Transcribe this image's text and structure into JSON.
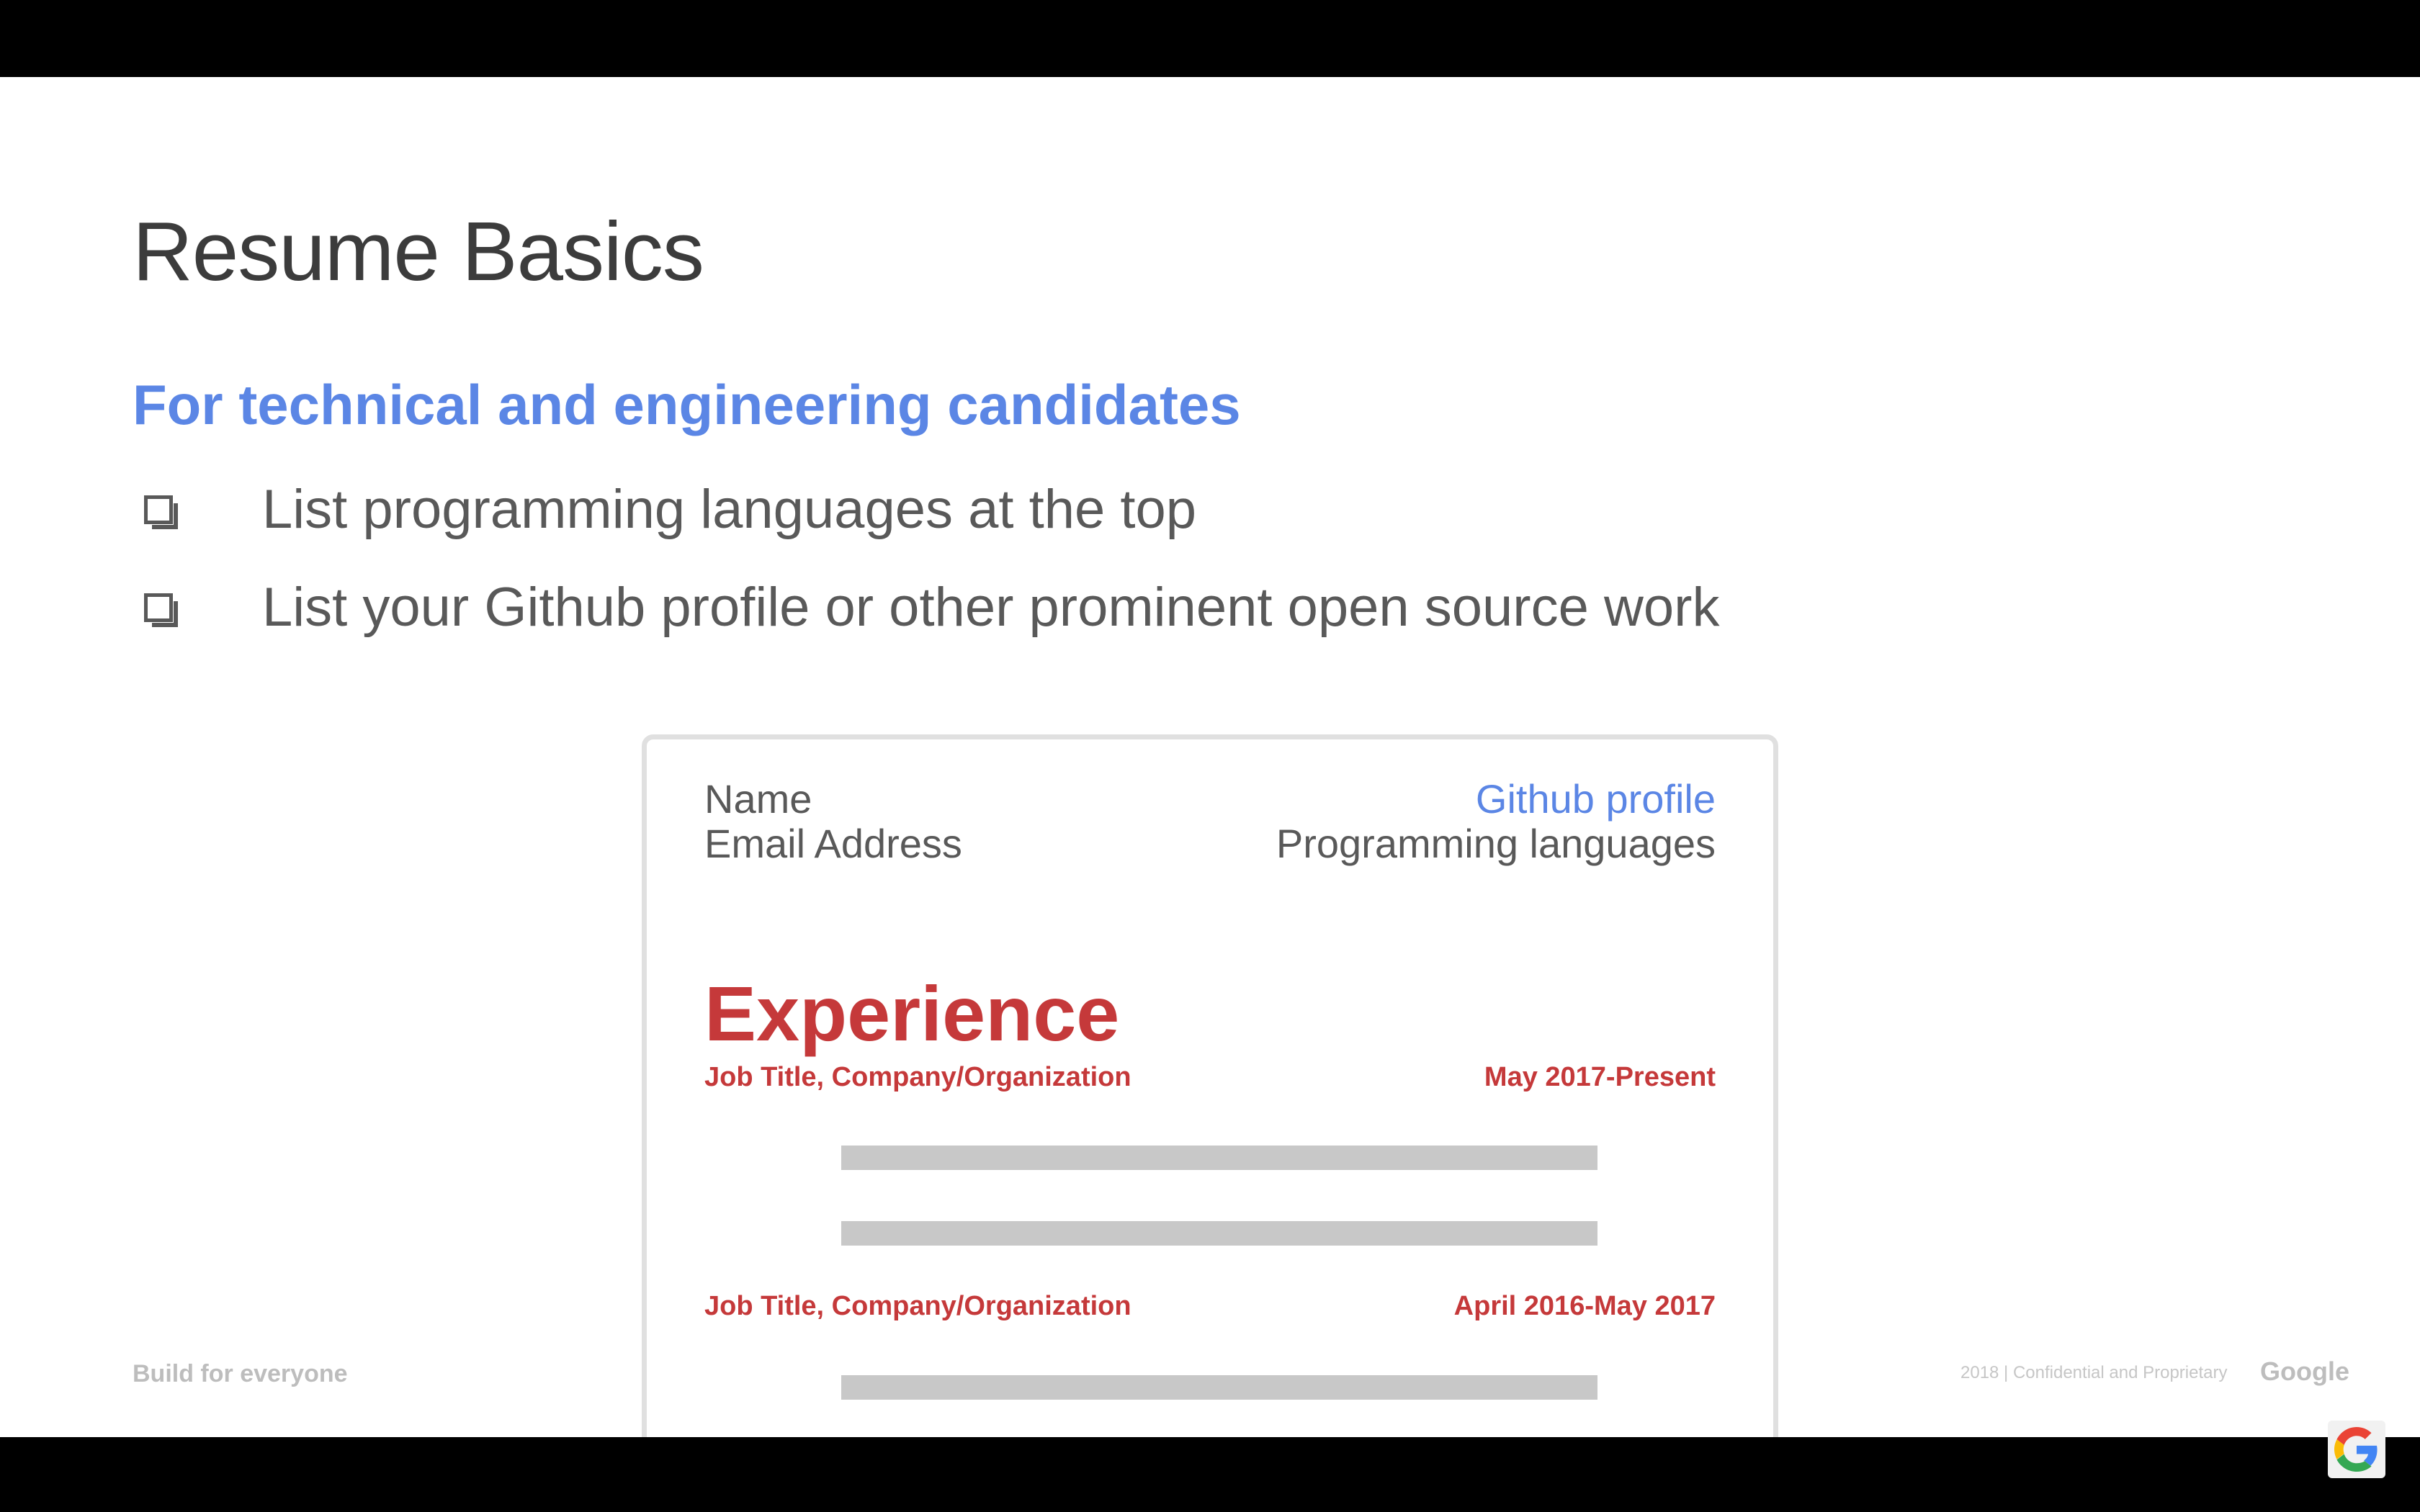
{
  "slide": {
    "title": "Resume Basics",
    "subtitle": "For technical and engineering candidates",
    "bullets": [
      "List programming languages at the top",
      "List your Github profile or other prominent open source work"
    ]
  },
  "resume_card": {
    "name": "Name",
    "email": "Email Address",
    "github": "Github profile",
    "languages": "Programming languages",
    "section_title": "Experience",
    "jobs": [
      {
        "title": "Job Title, Company/Organization",
        "dates": "May 2017-Present"
      },
      {
        "title": "Job Title, Company/Organization",
        "dates": "April 2016-May 2017"
      }
    ]
  },
  "footer": {
    "left": "Build for everyone",
    "right": "2018  |  Confidential and Proprietary",
    "brand": "Google"
  },
  "colors": {
    "accent_blue": "#5b86e5",
    "accent_red": "#c5393a",
    "text_gray": "#595959"
  },
  "icons": {
    "corner_logo": "google-g-icon"
  }
}
